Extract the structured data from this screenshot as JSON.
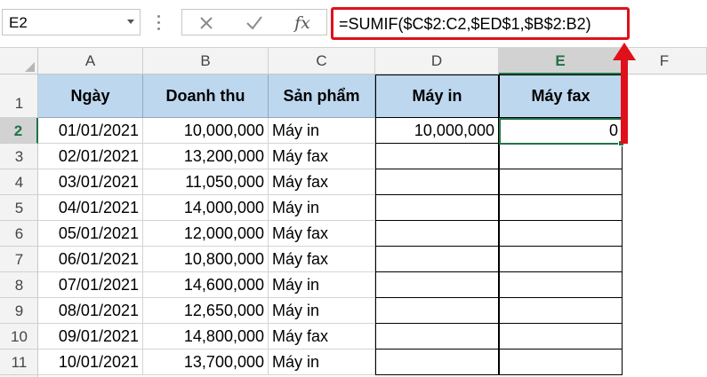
{
  "formula_bar": {
    "name_box": "E2",
    "formula": "=SUMIF($C$2:C2,$ED$1,$B$2:B2)",
    "cancel_icon": "x-cancel-icon",
    "enter_icon": "check-enter-icon",
    "function_label": "fx"
  },
  "columns": [
    "A",
    "B",
    "C",
    "D",
    "E",
    "F"
  ],
  "active_column": "E",
  "active_row": "2",
  "rows": [
    "1",
    "2",
    "3",
    "4",
    "5",
    "6",
    "7",
    "8",
    "9",
    "10",
    "11"
  ],
  "table": {
    "headers": [
      "Ngày",
      "Doanh thu",
      "Sản phẩm",
      "Máy in",
      "Máy fax"
    ],
    "data": [
      [
        "01/01/2021",
        "10,000,000",
        "Máy in",
        "10,000,000",
        "0"
      ],
      [
        "02/01/2021",
        "13,200,000",
        "Máy fax",
        "",
        ""
      ],
      [
        "03/01/2021",
        "11,050,000",
        "Máy fax",
        "",
        ""
      ],
      [
        "04/01/2021",
        "14,000,000",
        "Máy in",
        "",
        ""
      ],
      [
        "05/01/2021",
        "12,000,000",
        "Máy fax",
        "",
        ""
      ],
      [
        "06/01/2021",
        "10,800,000",
        "Máy fax",
        "",
        ""
      ],
      [
        "07/01/2021",
        "14,600,000",
        "Máy in",
        "",
        ""
      ],
      [
        "08/01/2021",
        "12,650,000",
        "Máy in",
        "",
        ""
      ],
      [
        "09/01/2021",
        "14,800,000",
        "Máy fax",
        "",
        ""
      ],
      [
        "10/01/2021",
        "13,700,000",
        "Máy in",
        "",
        ""
      ]
    ]
  },
  "colors": {
    "header_fill": "#bdd7ee",
    "selection": "#217346",
    "highlight": "#e0101b"
  }
}
